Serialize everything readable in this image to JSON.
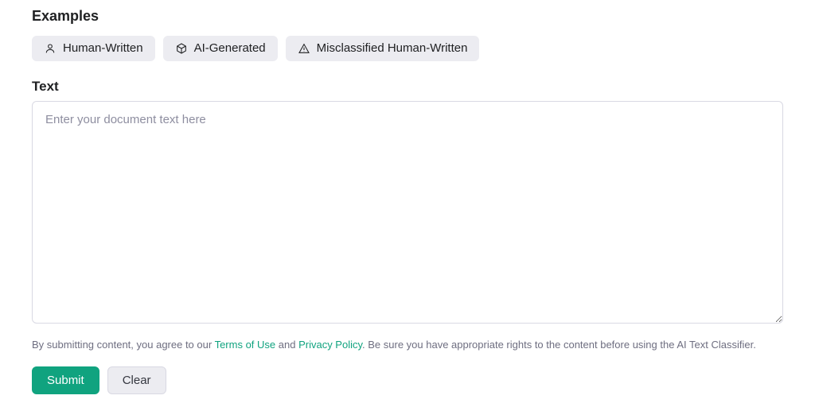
{
  "examples": {
    "heading": "Examples",
    "chips": [
      {
        "label": "Human-Written"
      },
      {
        "label": "AI-Generated"
      },
      {
        "label": "Misclassified Human-Written"
      }
    ]
  },
  "text_section": {
    "label": "Text",
    "placeholder": "Enter your document text here",
    "value": ""
  },
  "disclaimer": {
    "pre": "By submitting content, you agree to our ",
    "terms": "Terms of Use",
    "mid": " and ",
    "privacy": "Privacy Policy",
    "post": ". Be sure you have appropriate rights to the content before using the AI Text Classifier."
  },
  "buttons": {
    "submit": "Submit",
    "clear": "Clear"
  },
  "colors": {
    "accent": "#10a37f",
    "chip_bg": "#ececf1",
    "border": "#d9d9e3",
    "muted_text": "#6e6e80"
  }
}
